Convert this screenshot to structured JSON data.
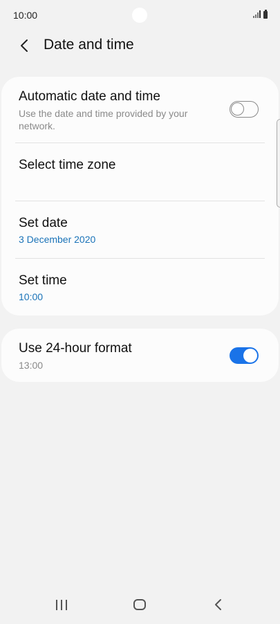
{
  "status_bar": {
    "time": "10:00"
  },
  "header": {
    "title": "Date and time"
  },
  "settings": {
    "automatic": {
      "title": "Automatic date and time",
      "description_line1": "Use the date and time provided by your",
      "description_line2": "network.",
      "enabled": false
    },
    "time_zone": {
      "title": "Select time zone"
    },
    "date": {
      "title": "Set date",
      "value": "3 December 2020"
    },
    "time": {
      "title": "Set time",
      "value": "10:00"
    },
    "format_24h": {
      "title": "Use 24-hour format",
      "value": "13:00",
      "enabled": true
    }
  },
  "colors": {
    "accent": "#1a73e8",
    "link_blue": "#1a73b8",
    "background": "#f2f2f2",
    "card": "#fcfcfc"
  },
  "nav_bar": {
    "icons": [
      "recents-icon",
      "home-icon",
      "back-icon"
    ]
  }
}
